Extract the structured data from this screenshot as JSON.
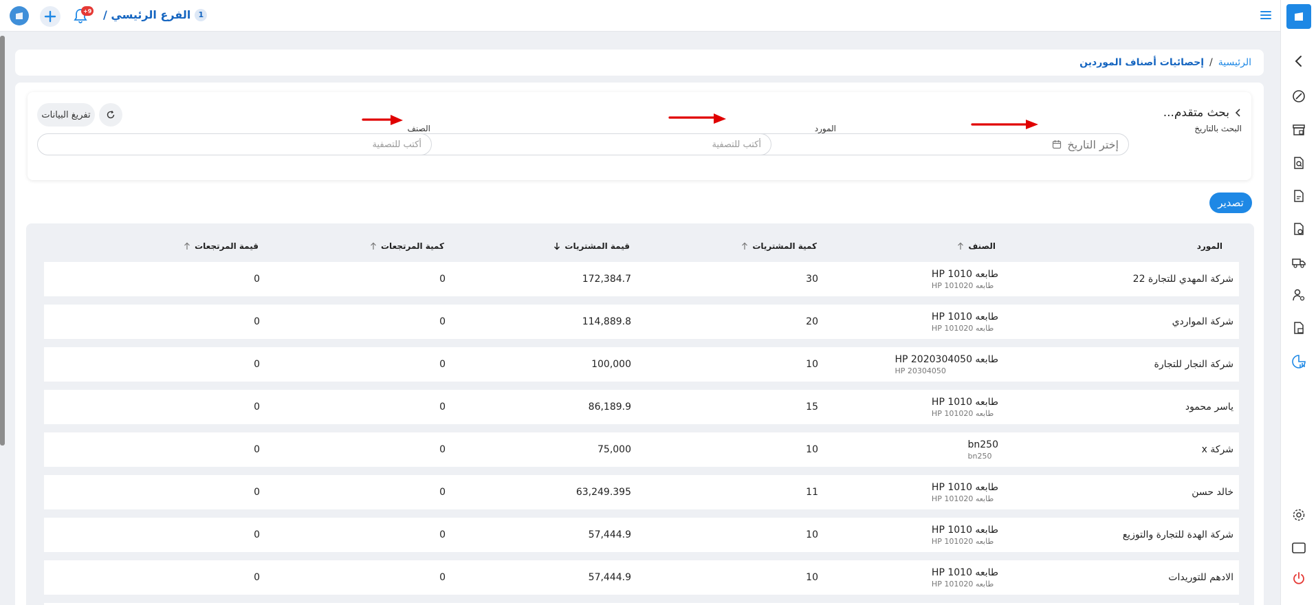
{
  "topbar": {
    "branch_name": "الفرع الرئيسي /",
    "branch_number": "1",
    "notification_badge": "+9"
  },
  "breadcrumb": {
    "home": "الرئيسية",
    "separator": "/",
    "current": "إحصائيات أصناف الموردين"
  },
  "search": {
    "title": "بحث متقدم...",
    "date_label": "البحث بالتاريخ",
    "date_placeholder": "إختر التاريخ",
    "supplier_label": "المورد",
    "supplier_placeholder": "أكتب للتصفية",
    "item_label": "الصنف",
    "item_placeholder": "أكتب للتصفية",
    "clear_button": "تفريغ البيانات"
  },
  "export_label": "تصدير",
  "table": {
    "headers": {
      "supplier": "المورد",
      "item": "الصنف",
      "purchase_qty": "كمية المشتريات",
      "purchase_value": "قيمة المشتريات",
      "return_qty": "كمية المرتجعات",
      "return_value": "قيمة المرتجعات"
    },
    "rows": [
      {
        "supplier": "شركة المهدي للتجارة 22",
        "item": "طابعه HP 1010",
        "item_code": "طابعه HP 101020",
        "purchase_qty": "30",
        "purchase_value": "172,384.7",
        "return_qty": "0",
        "return_value": "0"
      },
      {
        "supplier": "شركة المواردي",
        "item": "طابعه HP 1010",
        "item_code": "طابعه HP 101020",
        "purchase_qty": "20",
        "purchase_value": "114,889.8",
        "return_qty": "0",
        "return_value": "0"
      },
      {
        "supplier": "شركة النجار للتجارة",
        "item": "طابعه HP 2020304050",
        "item_code": "HP 20304050",
        "purchase_qty": "10",
        "purchase_value": "100,000",
        "return_qty": "0",
        "return_value": "0"
      },
      {
        "supplier": "ياسر محمود",
        "item": "طابعه HP 1010",
        "item_code": "طابعه HP 101020",
        "purchase_qty": "15",
        "purchase_value": "86,189.9",
        "return_qty": "0",
        "return_value": "0"
      },
      {
        "supplier": "شركة x",
        "item": "bn250",
        "item_code": "bn250",
        "purchase_qty": "10",
        "purchase_value": "75,000",
        "return_qty": "0",
        "return_value": "0"
      },
      {
        "supplier": "خالد حسن",
        "item": "طابعه HP 1010",
        "item_code": "طابعه HP 101020",
        "purchase_qty": "11",
        "purchase_value": "63,249.395",
        "return_qty": "0",
        "return_value": "0"
      },
      {
        "supplier": "شركة الهدة للتجارة والتوزيع",
        "item": "طابعه HP 1010",
        "item_code": "طابعه HP 101020",
        "purchase_qty": "10",
        "purchase_value": "57,444.9",
        "return_qty": "0",
        "return_value": "0"
      },
      {
        "supplier": "الادهم للتوريدات",
        "item": "طابعه HP 1010",
        "item_code": "طابعه HP 101020",
        "purchase_qty": "10",
        "purchase_value": "57,444.9",
        "return_qty": "0",
        "return_value": "0"
      }
    ]
  },
  "colors": {
    "primary": "#1e88e5",
    "annotation_arrow": "#e00000"
  }
}
